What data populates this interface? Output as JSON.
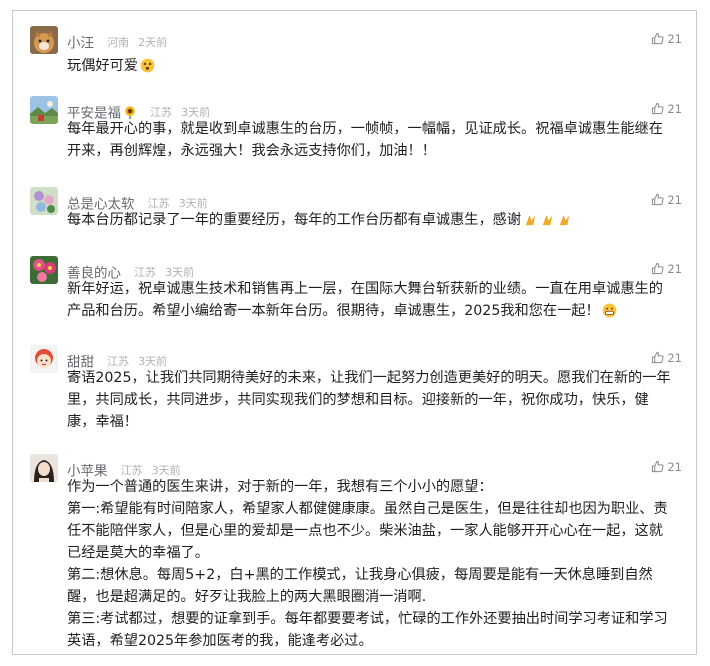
{
  "comments": [
    {
      "name": "小汪",
      "location": "河南",
      "time": "2天前",
      "likes": "21",
      "avatar_icon": "dog-photo-avatar",
      "paragraphs": [
        "玩偶好可爱"
      ],
      "emoji": "dizzy-face-emoji"
    },
    {
      "name": "平安是福",
      "name_badge": "sunflower-emoji",
      "location": "江苏",
      "time": "3天前",
      "likes": "21",
      "avatar_icon": "landscape-photo-avatar",
      "paragraphs": [
        "每年最开心的事，就是收到卓诚惠生的台历，一帧帧，一幅幅，见证成长。祝福卓诚惠生能继在开来，再创辉煌，永远强大！我会永远支持你们，加油！！"
      ]
    },
    {
      "name": "总是心太软",
      "location": "江苏",
      "time": "3天前",
      "likes": "21",
      "avatar_icon": "flowers-photo-avatar",
      "paragraphs": [
        "每本台历都记录了一年的重要经历，每年的工作台历都有卓诚惠生，感谢"
      ],
      "emoji": "folded-hands-emoji-x3"
    },
    {
      "name": "善良的心",
      "location": "江苏",
      "time": "3天前",
      "likes": "21",
      "avatar_icon": "pink-flowers-avatar",
      "paragraphs": [
        "新年好运，祝卓诚惠生技术和销售再上一层，在国际大舞台斩获新的业绩。一直在用卓诚惠生的产品和台历。希望小编给寄一本新年台历。很期待，卓诚惠生，2025我和您在一起！"
      ],
      "emoji": "grinning-face-emoji"
    },
    {
      "name": "甜甜",
      "location": "江苏",
      "time": "3天前",
      "likes": "21",
      "avatar_icon": "cartoon-girl-avatar",
      "paragraphs": [
        "寄语2025，让我们共同期待美好的未来，让我们一起努力创造更美好的明天。愿我们在新的一年里，共同成长，共同进步，共同实现我们的梦想和目标。迎接新的一年，祝你成功，快乐，健康，幸福！"
      ]
    },
    {
      "name": "小苹果",
      "location": "江苏",
      "time": "3天前",
      "likes": "21",
      "avatar_icon": "portrait-photo-avatar",
      "paragraphs": [
        "作为一个普通的医生来讲，对于新的一年，我想有三个小小的愿望：",
        "第一:希望能有时间陪家人，希望家人都健健康康。虽然自己是医生，但是往往却也因为职业、责任不能陪伴家人，但是心里的爱却是一点也不少。柴米油盐，一家人能够开开心心在一起，这就已经是莫大的幸福了。",
        "第二:想休息。每周5+2，白+黑的工作模式，让我身心俱疲，每周要是能有一天休息睡到自然醒，也是超满足的。好歹让我脸上的两大黑眼圈消一消啊.",
        "第三:考试都过，想要的证拿到手。每年都要要考试，忙碌的工作外还要抽出时间学习考证和学习英语，希望2025年参加医考的我，能逢考必过。"
      ]
    }
  ]
}
